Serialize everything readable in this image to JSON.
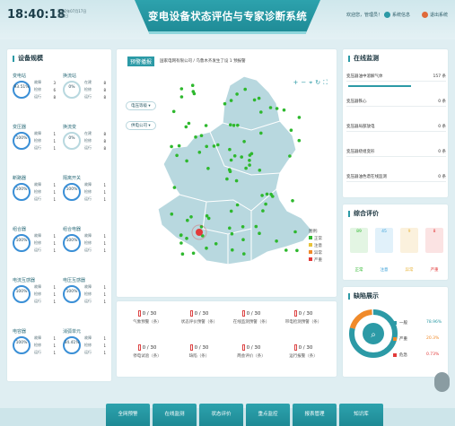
{
  "header": {
    "time": "18:40:18",
    "date": "2022年07月17日",
    "weekday": "星期日",
    "title": "变电设备状态评估与专家诊断系统",
    "welcome": "欢迎您，管理员！",
    "system_info": "系统信息",
    "logout": "退出系统"
  },
  "left": {
    "title": "设备规模",
    "cards": [
      {
        "name": "变电站",
        "pct": "93.51%",
        "rows": [
          [
            "故障",
            "3"
          ],
          [
            "检修",
            "6"
          ],
          [
            "运行",
            "8"
          ]
        ]
      },
      {
        "name": "换流站",
        "pct": "0%",
        "rows": [
          [
            "在建",
            "8"
          ],
          [
            "检修",
            "8"
          ],
          [
            "运行",
            "8"
          ]
        ]
      },
      {
        "name": "变压器",
        "pct": "100%",
        "rows": [
          [
            "故障",
            "1"
          ],
          [
            "检修",
            "1"
          ],
          [
            "运行",
            "1"
          ]
        ]
      },
      {
        "name": "换流变",
        "pct": "0%",
        "rows": [
          [
            "在建",
            "8"
          ],
          [
            "检修",
            "8"
          ],
          [
            "运行",
            "8"
          ]
        ]
      },
      {
        "name": "断路器",
        "pct": "100%",
        "rows": [
          [
            "故障",
            "1"
          ],
          [
            "检修",
            "1"
          ],
          [
            "运行",
            "1"
          ]
        ]
      },
      {
        "name": "隔离开关",
        "pct": "100%",
        "rows": [
          [
            "故障",
            "1"
          ],
          [
            "检修",
            "1"
          ],
          [
            "运行",
            "1"
          ]
        ]
      },
      {
        "name": "组合器",
        "pct": "100%",
        "rows": [
          [
            "故障",
            "1"
          ],
          [
            "检修",
            "1"
          ],
          [
            "运行",
            "1"
          ]
        ]
      },
      {
        "name": "组合电器",
        "pct": "100%",
        "rows": [
          [
            "故障",
            "1"
          ],
          [
            "检修",
            "1"
          ],
          [
            "运行",
            "1"
          ]
        ]
      },
      {
        "name": "电流互感器",
        "pct": "100%",
        "rows": [
          [
            "故障",
            "1"
          ],
          [
            "检修",
            "1"
          ],
          [
            "运行",
            "1"
          ]
        ]
      },
      {
        "name": "电压互感器",
        "pct": "100%",
        "rows": [
          [
            "故障",
            "1"
          ],
          [
            "检修",
            "1"
          ],
          [
            "运行",
            "1"
          ]
        ]
      },
      {
        "name": "电容器",
        "pct": "100%",
        "rows": [
          [
            "故障",
            "1"
          ],
          [
            "检修",
            "1"
          ],
          [
            "运行",
            "1"
          ]
        ]
      },
      {
        "name": "消弧单元",
        "pct": "34.41%",
        "rows": [
          [
            "故障",
            "1"
          ],
          [
            "检修",
            "1"
          ],
          [
            "运行",
            "1"
          ]
        ]
      }
    ]
  },
  "center": {
    "warn_title": "预警播报",
    "warn_text": "国家电网有限公司 / 乌鲁木齐发生了设 1 预报警",
    "chip1": "电压等级",
    "chip2": "供电公司",
    "legend_title": "图例:",
    "legend": [
      {
        "label": "正常",
        "color": "#2eb82e"
      },
      {
        "label": "注意",
        "color": "#e8c33a"
      },
      {
        "label": "异常",
        "color": "#f08a2a"
      },
      {
        "label": "严重",
        "color": "#e23a3a"
      }
    ],
    "stats": [
      {
        "v": "0 / 30",
        "label": "气象预警（条）"
      },
      {
        "v": "0 / 30",
        "label": "状态评价预警（条）"
      },
      {
        "v": "0 / 30",
        "label": "在线监测预警（条）"
      },
      {
        "v": "0 / 30",
        "label": "带电检测预警（条）"
      },
      {
        "v": "0 / 30",
        "label": "停电试验（条）"
      },
      {
        "v": "0 / 30",
        "label": "缺陷（条）"
      },
      {
        "v": "0 / 30",
        "label": "两会评价（条）"
      },
      {
        "v": "0 / 30",
        "label": "运行报警（条）"
      }
    ]
  },
  "right": {
    "monitor_title": "在线监测",
    "monitor": [
      {
        "label": "变压器油中溶解气体",
        "count": "157 条"
      },
      {
        "label": "变压器铁心",
        "count": "0 条"
      },
      {
        "label": "变压器局部放电",
        "count": "0 条"
      },
      {
        "label": "变压器绕组变形",
        "count": "0 条"
      },
      {
        "label": "变压器油色谱在线监测",
        "count": "0 条"
      }
    ],
    "eval_title": "综合评价",
    "eval": [
      {
        "n": "89",
        "label": "正常",
        "color": "#2eb82e",
        "bg": "#e3f5e3"
      },
      {
        "n": "45",
        "label": "注意",
        "color": "#3aa0d8",
        "bg": "#e1f1fa"
      },
      {
        "n": "9",
        "label": "异常",
        "color": "#e8b43a",
        "bg": "#fbf1dd"
      },
      {
        "n": "8",
        "label": "严重",
        "color": "#e23a3a",
        "bg": "#fbe3e3"
      }
    ],
    "defect_title": "缺陷展示",
    "defects": [
      {
        "label": "一般",
        "pct": "78.96%",
        "color": "#2c9aa6"
      },
      {
        "label": "严重",
        "pct": "20.3%",
        "color": "#f08a2a"
      },
      {
        "label": "危急",
        "pct": "0.73%",
        "color": "#e23a3a"
      }
    ]
  },
  "nav": [
    "全网预警",
    "在线监测",
    "状态评价",
    "重点监控",
    "报表管理",
    "知识库"
  ]
}
